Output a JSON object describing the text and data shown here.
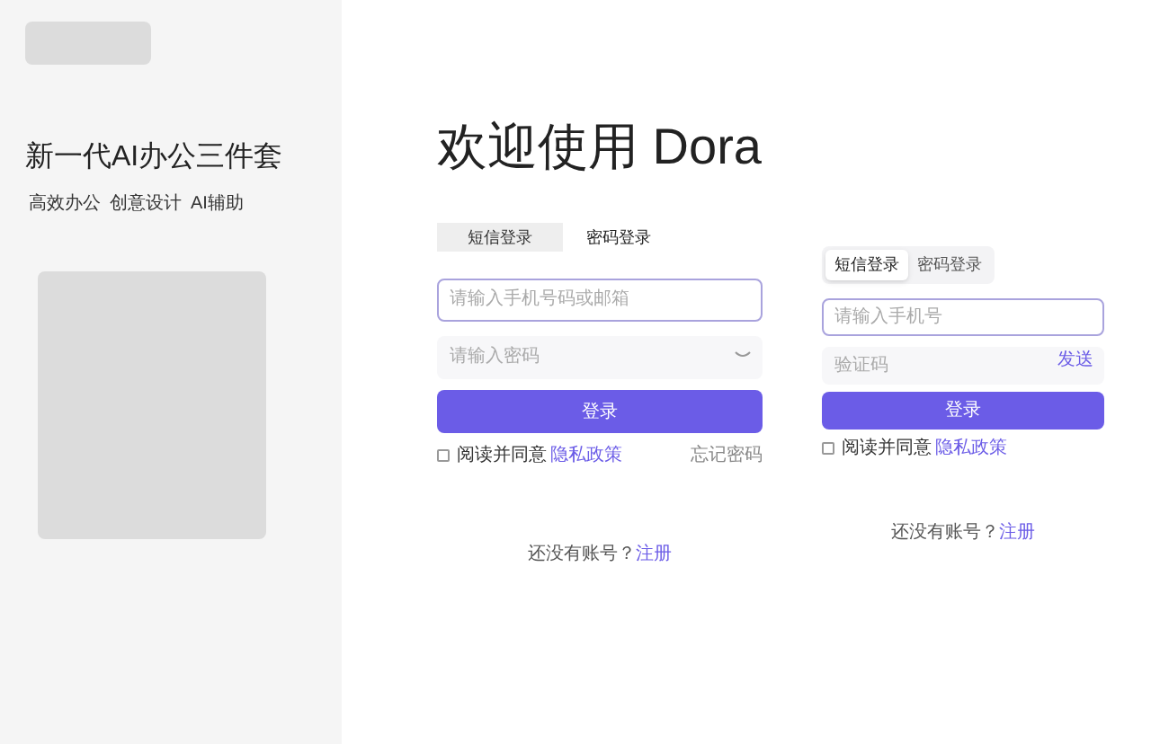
{
  "sidebar": {
    "tagline": "新一代AI办公三件套",
    "features": [
      "高效办公",
      "创意设计",
      "AI辅助"
    ]
  },
  "welcome": {
    "title": "欢迎使用 Dora"
  },
  "forms": [
    {
      "tabs": [
        {
          "label": "短信登录",
          "selected": true
        },
        {
          "label": "密码登录",
          "selected": false
        }
      ],
      "fields": [
        {
          "kind": "text",
          "placeholder": "请输入手机号码或邮箱",
          "focused": true
        },
        {
          "kind": "password",
          "placeholder": "请输入密码",
          "focused": false
        }
      ],
      "submit": "登录",
      "agreement": {
        "text": "阅读并同意",
        "link": "隐私政策",
        "checked": false
      },
      "forgot": "忘记密码",
      "register": {
        "prompt": "还没有账号？",
        "link": "注册"
      }
    },
    {
      "tabs": [
        {
          "label": "短信登录",
          "selected": true
        },
        {
          "label": "密码登录",
          "selected": false
        }
      ],
      "fields": [
        {
          "kind": "text",
          "placeholder": "请输入手机号",
          "focused": true
        },
        {
          "kind": "code",
          "placeholder": "验证码",
          "action": "发送",
          "focused": false
        }
      ],
      "submit": "登录",
      "agreement": {
        "text": "阅读并同意",
        "link": "隐私政策",
        "checked": false
      },
      "register": {
        "prompt": "还没有账号？",
        "link": "注册"
      }
    }
  ]
}
